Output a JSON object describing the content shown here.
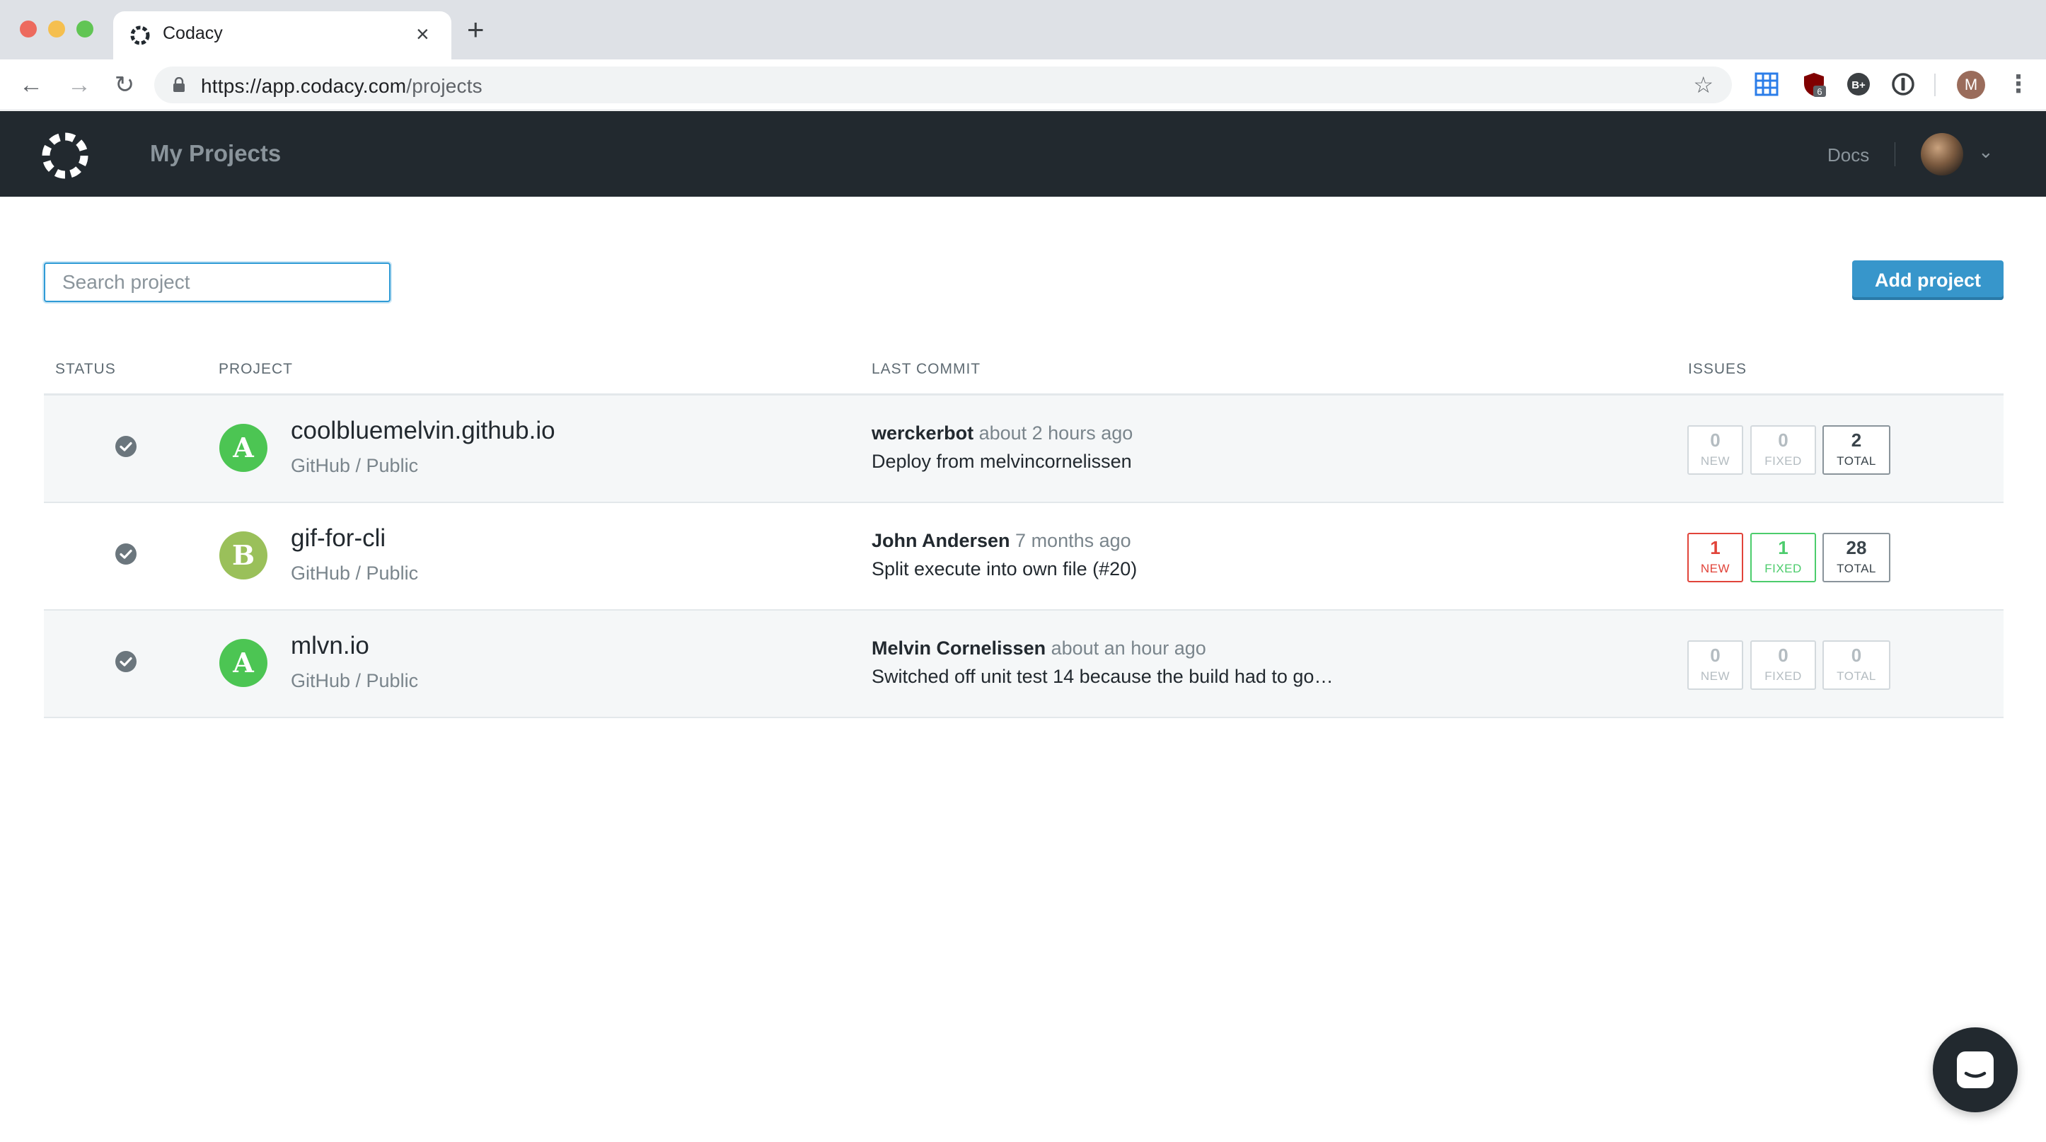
{
  "browser": {
    "tab_title": "Codacy",
    "tab_close": "×",
    "new_tab": "+",
    "url_host": "https://app.codacy.com",
    "url_path": "/projects",
    "back_glyph": "←",
    "forward_glyph": "→",
    "reload_glyph": "↻",
    "star_glyph": "☆",
    "profile_initial": "M",
    "menu_glyph": "⋮",
    "extensions": [
      "grid-extension-icon",
      "ublock-icon",
      "bplus-extension-icon",
      "onepassword-icon"
    ],
    "ublock_count": "6",
    "bplus_label": "B+"
  },
  "header": {
    "title": "My Projects",
    "docs_label": "Docs",
    "caret": "⌄"
  },
  "search": {
    "placeholder": "Search project",
    "value": ""
  },
  "toolbar": {
    "add_label": "Add project"
  },
  "table": {
    "columns": {
      "status": "STATUS",
      "project": "PROJECT",
      "last_commit": "LAST COMMIT",
      "issues": "ISSUES"
    },
    "rows": [
      {
        "status": "ok",
        "grade": "A",
        "grade_color": "#4cc553",
        "name": "coolbluemelvin.github.io",
        "meta": "GitHub / Public",
        "commit_author": "werckerbot",
        "commit_time": "about 2 hours ago",
        "commit_message": "Deploy from melvincornelissen",
        "issues": {
          "new": "0",
          "fixed": "0",
          "total": "2",
          "new_label": "NEW",
          "fixed_label": "FIXED",
          "total_label": "TOTAL"
        }
      },
      {
        "status": "ok",
        "grade": "B",
        "grade_color": "#9ac05a",
        "name": "gif-for-cli",
        "meta": "GitHub / Public",
        "commit_author": "John Andersen",
        "commit_time": "7 months ago",
        "commit_message": "Split execute into own file (#20)",
        "issues": {
          "new": "1",
          "fixed": "1",
          "total": "28",
          "new_label": "NEW",
          "fixed_label": "FIXED",
          "total_label": "TOTAL"
        }
      },
      {
        "status": "ok",
        "grade": "A",
        "grade_color": "#4cc553",
        "name": "mlvn.io",
        "meta": "GitHub / Public",
        "commit_author": "Melvin Cornelissen",
        "commit_time": "about an hour ago",
        "commit_message": "Switched off unit test 14 because the build had to go…",
        "issues": {
          "new": "0",
          "fixed": "0",
          "total": "0",
          "new_label": "NEW",
          "fixed_label": "FIXED",
          "total_label": "TOTAL"
        }
      }
    ]
  },
  "colors": {
    "header_bg": "#22292f",
    "accent": "#3796cb",
    "new_issue": "#e1443a",
    "fixed_issue": "#4ccc6c"
  }
}
